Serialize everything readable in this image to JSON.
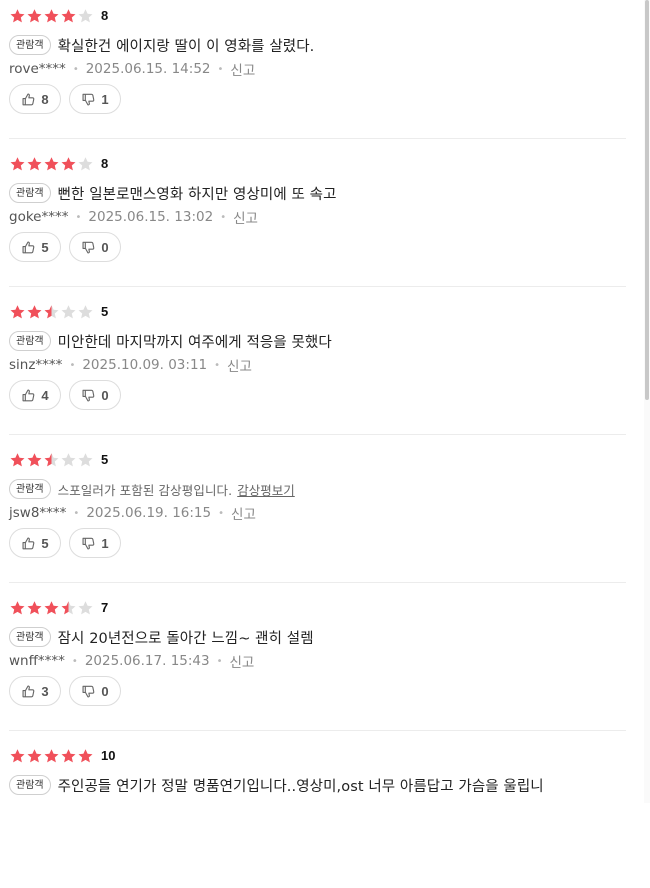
{
  "reviews": [
    {
      "rating": 8,
      "badge": "관람객",
      "comment": "확실한건 에이지랑 딸이 이 영화를 살렸다.",
      "spoiler": false,
      "spoiler_link": "",
      "user": "rove****",
      "date": "2025.06.15. 14:52",
      "report": "신고",
      "likes": "8",
      "dislikes": "1"
    },
    {
      "rating": 8,
      "badge": "관람객",
      "comment": "뻔한 일본로맨스영화 하지만 영상미에 또 속고",
      "spoiler": false,
      "spoiler_link": "",
      "user": "goke****",
      "date": "2025.06.15. 13:02",
      "report": "신고",
      "likes": "5",
      "dislikes": "0"
    },
    {
      "rating": 5,
      "badge": "관람객",
      "comment": "미안한데 마지막까지 여주에게 적응을 못했다",
      "spoiler": false,
      "spoiler_link": "",
      "user": "sinz****",
      "date": "2025.10.09. 03:11",
      "report": "신고",
      "likes": "4",
      "dislikes": "0"
    },
    {
      "rating": 5,
      "badge": "관람객",
      "comment": "스포일러가 포함된 감상평입니다.",
      "spoiler": true,
      "spoiler_link": "감상평보기",
      "user": "jsw8****",
      "date": "2025.06.19. 16:15",
      "report": "신고",
      "likes": "5",
      "dislikes": "1"
    },
    {
      "rating": 7,
      "badge": "관람객",
      "comment": "잠시 20년전으로 돌아간 느낌~ 괜히 설렘",
      "spoiler": false,
      "spoiler_link": "",
      "user": "wnff****",
      "date": "2025.06.17. 15:43",
      "report": "신고",
      "likes": "3",
      "dislikes": "0"
    },
    {
      "rating": 10,
      "badge": "관람객",
      "comment": "주인공들 연기가 정말 명품연기입니다..영상미,ost 너무 아름답고 가슴을 울립니",
      "spoiler": false,
      "spoiler_link": "",
      "user": "",
      "date": "",
      "report": "",
      "likes": "",
      "dislikes": ""
    }
  ],
  "colors": {
    "star_on": "#f0505a",
    "star_off": "#dddddd"
  },
  "icons": {
    "star": "star-icon",
    "like": "thumbs-up-icon",
    "dislike": "thumbs-down-icon"
  }
}
